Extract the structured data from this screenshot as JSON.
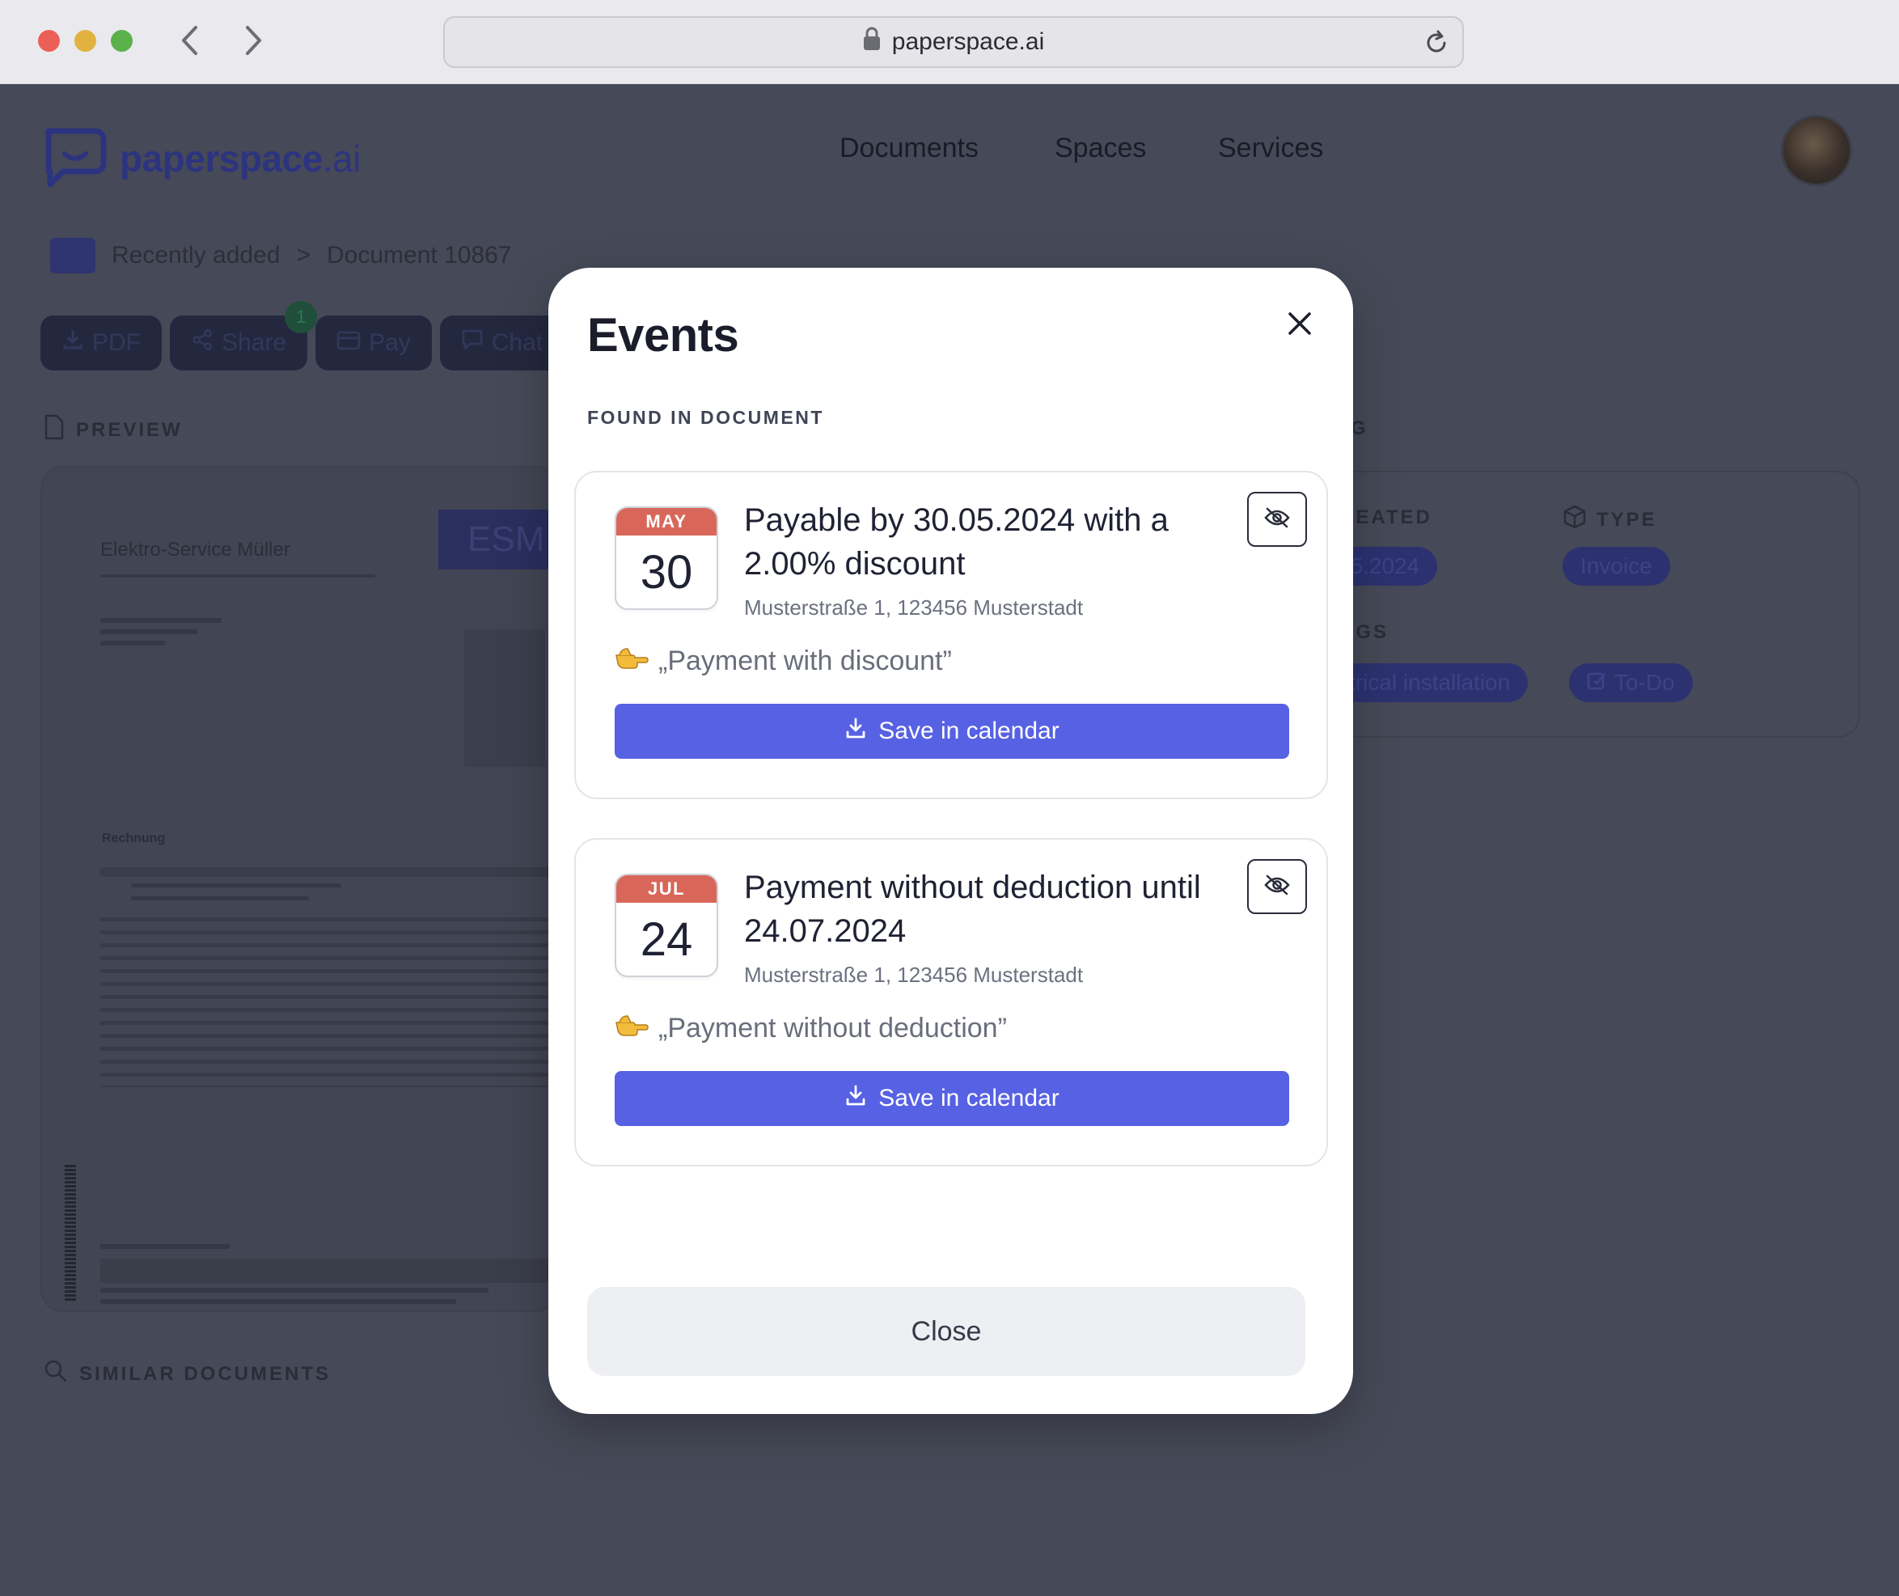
{
  "browser": {
    "url": "paperspace.ai"
  },
  "app": {
    "logo_main": "paperspace",
    "logo_suffix": ".ai",
    "nav": [
      "Documents",
      "Spaces",
      "Services"
    ],
    "breadcrumb": {
      "folder": "Recently added",
      "separator": ">",
      "current": "Document 10867"
    },
    "actions": {
      "pdf": "PDF",
      "share": "Share",
      "share_badge": "1",
      "pay": "Pay",
      "chat": "Chat"
    },
    "preview_title": "PREVIEW",
    "similar_title": "SIMILAR DOCUMENTS",
    "doc_preview": {
      "company": "Elektro-Service Müller",
      "logo": "ESM",
      "heading": "Rechnung"
    },
    "meta": {
      "section_letter": "G",
      "created_label": "REATED",
      "created_value": "05.2024",
      "type_label": "TYPE",
      "type_value": "Invoice",
      "tags_label": "AGS",
      "tags": [
        "ctrical installation",
        "To-Do"
      ]
    }
  },
  "modal": {
    "title": "Events",
    "section": "FOUND IN DOCUMENT",
    "events": [
      {
        "month": "MAY",
        "day": "30",
        "title": "Payable by 30.05.2024 with a 2.00% discount",
        "address": "Musterstraße 1, 123456 Musterstadt",
        "quote": "„Payment with discount”",
        "save_label": "Save in calendar"
      },
      {
        "month": "JUL",
        "day": "24",
        "title": "Payment without deduction until 24.07.2024",
        "address": "Musterstraße 1, 123456 Musterstadt",
        "quote": "„Payment without deduction”",
        "save_label": "Save in calendar"
      }
    ],
    "close_label": "Close"
  },
  "colors": {
    "accent": "#5661e3",
    "calendar_header": "#d8675a",
    "overlay_bg": "#464957"
  }
}
